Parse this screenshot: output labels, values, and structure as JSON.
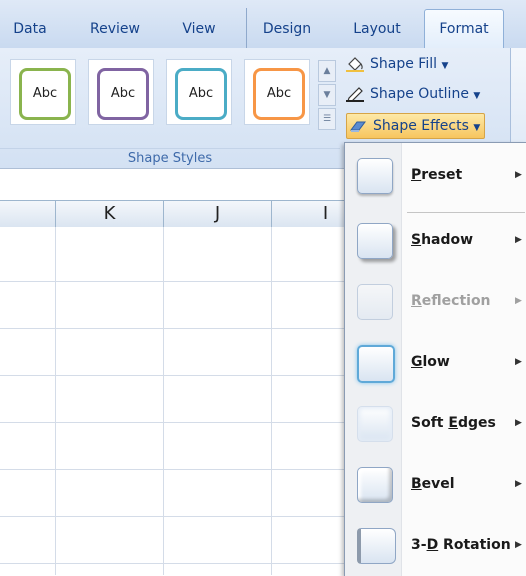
{
  "tabs": [
    {
      "label": "Data",
      "active": false
    },
    {
      "label": "Review",
      "active": false
    },
    {
      "label": "View",
      "active": false
    },
    {
      "label": "Design",
      "active": false
    },
    {
      "label": "Layout",
      "active": false
    },
    {
      "label": "Format",
      "active": true
    }
  ],
  "ribbon": {
    "styles": [
      {
        "text": "Abc",
        "border_color": "#8ab44e"
      },
      {
        "text": "Abc",
        "border_color": "#8064a2"
      },
      {
        "text": "Abc",
        "border_color": "#4bacc6"
      },
      {
        "text": "Abc",
        "border_color": "#f79646"
      }
    ],
    "group_label": "Shape Styles",
    "commands": {
      "shape_fill": "Shape Fill",
      "shape_outline": "Shape Outline",
      "shape_effects": "Shape Effects"
    }
  },
  "sheet": {
    "columns": [
      "K",
      "J",
      "I"
    ]
  },
  "menu": {
    "items": [
      {
        "pre": "",
        "key": "P",
        "post": "reset",
        "disabled": false
      },
      {
        "pre": "",
        "key": "S",
        "post": "hadow",
        "disabled": false
      },
      {
        "pre": "",
        "key": "R",
        "post": "eflection",
        "disabled": true
      },
      {
        "pre": "",
        "key": "G",
        "post": "low",
        "disabled": false
      },
      {
        "pre": "Soft ",
        "key": "E",
        "post": "dges",
        "disabled": false
      },
      {
        "pre": "",
        "key": "B",
        "post": "evel",
        "disabled": false
      },
      {
        "pre": "3-",
        "key": "D",
        "post": " Rotation",
        "disabled": false
      }
    ]
  }
}
